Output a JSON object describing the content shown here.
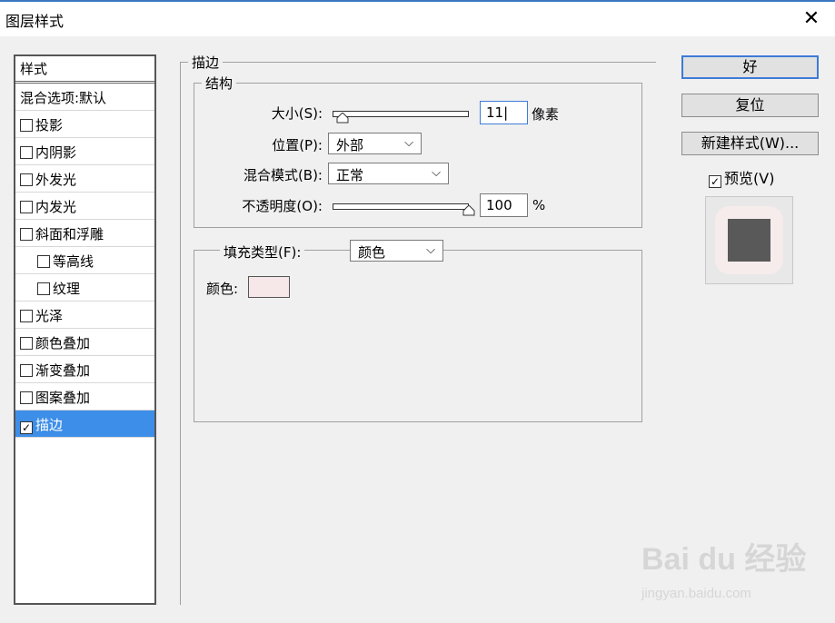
{
  "window": {
    "title": "图层样式",
    "close_glyph": "✕"
  },
  "style_list": {
    "header": "样式",
    "items": [
      {
        "label": "混合选项:默认",
        "checkbox": false,
        "checked": false,
        "sub": false,
        "selected": false
      },
      {
        "label": "投影",
        "checkbox": true,
        "checked": false,
        "sub": false,
        "selected": false
      },
      {
        "label": "内阴影",
        "checkbox": true,
        "checked": false,
        "sub": false,
        "selected": false
      },
      {
        "label": "外发光",
        "checkbox": true,
        "checked": false,
        "sub": false,
        "selected": false
      },
      {
        "label": "内发光",
        "checkbox": true,
        "checked": false,
        "sub": false,
        "selected": false
      },
      {
        "label": "斜面和浮雕",
        "checkbox": true,
        "checked": false,
        "sub": false,
        "selected": false
      },
      {
        "label": "等高线",
        "checkbox": true,
        "checked": false,
        "sub": true,
        "selected": false
      },
      {
        "label": "纹理",
        "checkbox": true,
        "checked": false,
        "sub": true,
        "selected": false
      },
      {
        "label": "光泽",
        "checkbox": true,
        "checked": false,
        "sub": false,
        "selected": false
      },
      {
        "label": "颜色叠加",
        "checkbox": true,
        "checked": false,
        "sub": false,
        "selected": false
      },
      {
        "label": "渐变叠加",
        "checkbox": true,
        "checked": false,
        "sub": false,
        "selected": false
      },
      {
        "label": "图案叠加",
        "checkbox": true,
        "checked": false,
        "sub": false,
        "selected": false
      },
      {
        "label": "描边",
        "checkbox": true,
        "checked": true,
        "sub": false,
        "selected": true
      }
    ]
  },
  "stroke": {
    "group_title": "描边",
    "structure": {
      "title": "结构",
      "size_label": "大小(S):",
      "size_value": "11",
      "size_unit": "像素",
      "size_slider_fraction": 0.04,
      "position_label": "位置(P):",
      "position_value": "外部",
      "blend_label": "混合模式(B):",
      "blend_value": "正常",
      "opacity_label": "不透明度(O):",
      "opacity_value": "100",
      "opacity_unit": "%",
      "opacity_slider_fraction": 1.0
    },
    "fill": {
      "fill_type_label": "填充类型(F):",
      "fill_type_value": "颜色",
      "color_label": "颜色:",
      "color_value": "#f6e8e8"
    }
  },
  "buttons": {
    "ok": "好",
    "reset": "复位",
    "new_style": "新建样式(W)...",
    "preview_label": "预览(V)",
    "preview_checked": true
  },
  "watermark": {
    "main": "Bai du 经验",
    "sub": "jingyan.baidu.com"
  },
  "icons": {
    "chevron": "chevron-down-icon",
    "check": "checkmark-icon",
    "close": "close-icon"
  }
}
